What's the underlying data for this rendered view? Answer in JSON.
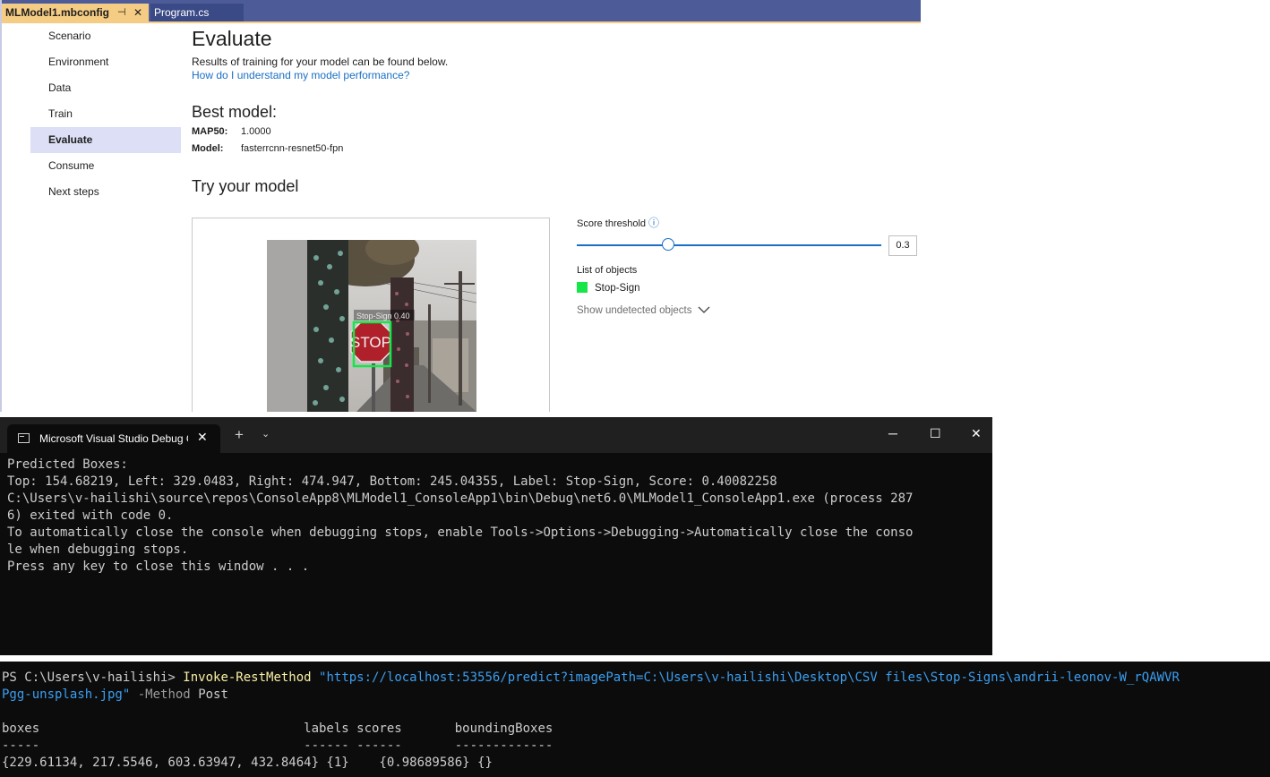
{
  "vs": {
    "tabs": [
      {
        "label": "MLModel1.mbconfig",
        "pin": "⊣",
        "close": "✕"
      },
      {
        "label": "Program.cs"
      }
    ],
    "nav": [
      "Scenario",
      "Environment",
      "Data",
      "Train",
      "Evaluate",
      "Consume",
      "Next steps"
    ],
    "nav_active": "Evaluate",
    "title": "Evaluate",
    "subtitle": "Results of training for your model can be found below.",
    "help_link": "How do I understand my model performance?",
    "best_model_title": "Best model:",
    "metrics": [
      {
        "label": "MAP50:",
        "value": "1.0000"
      },
      {
        "label": "Model:",
        "value": "fasterrcnn-resnet50-fpn"
      }
    ],
    "try_title": "Try your model",
    "detection_label": "Stop-Sign 0.40",
    "sign_text": "STOP",
    "score_threshold_label": "Score threshold",
    "threshold_value": "0.3",
    "threshold_fraction": 0.3,
    "list_label": "List of objects",
    "objects": [
      {
        "name": "Stop-Sign",
        "color": "#16e64a"
      }
    ],
    "show_undetected": "Show undetected objects"
  },
  "debug_console": {
    "tab_title": "Microsoft Visual Studio Debug Console",
    "lines": [
      "",
      "",
      "Predicted Boxes:",
      "",
      "Top: 154.68219, Left: 329.0483, Right: 474.947, Bottom: 245.04355, Label: Stop-Sign, Score: 0.40082258",
      "",
      "C:\\Users\\v-hailishi\\source\\repos\\ConsoleApp8\\MLModel1_ConsoleApp1\\bin\\Debug\\net6.0\\MLModel1_ConsoleApp1.exe (process 287",
      "6) exited with code 0.",
      "To automatically close the console when debugging stops, enable Tools->Options->Debugging->Automatically close the conso",
      "le when debugging stops.",
      "Press any key to close this window . . ."
    ]
  },
  "powershell": {
    "prompt": "PS C:\\Users\\v-hailishi> ",
    "command": "Invoke-RestMethod",
    "url_line1": "\"https://localhost:53556/predict?imagePath=C:\\Users\\v-hailishi\\Desktop\\CSV files\\Stop-Signs\\andrii-leonov-W_rQAWVR",
    "url_line2": "Pgg-unsplash.jpg\"",
    "param": "-Method",
    "param_value": "Post",
    "table_header": "boxes                                   labels scores       boundingBoxes",
    "table_rule": "-----                                   ------ ------       -------------",
    "table_row": "{229.61134, 217.5546, 603.63947, 432.8464} {1}    {0.98689586} {}"
  },
  "colors": {
    "tab_bar": "#4d5c99",
    "active_tab": "#f5cc84",
    "link": "#1a6fc4",
    "detection_box": "#16e64a",
    "console_bg": "#0c0c0c"
  }
}
